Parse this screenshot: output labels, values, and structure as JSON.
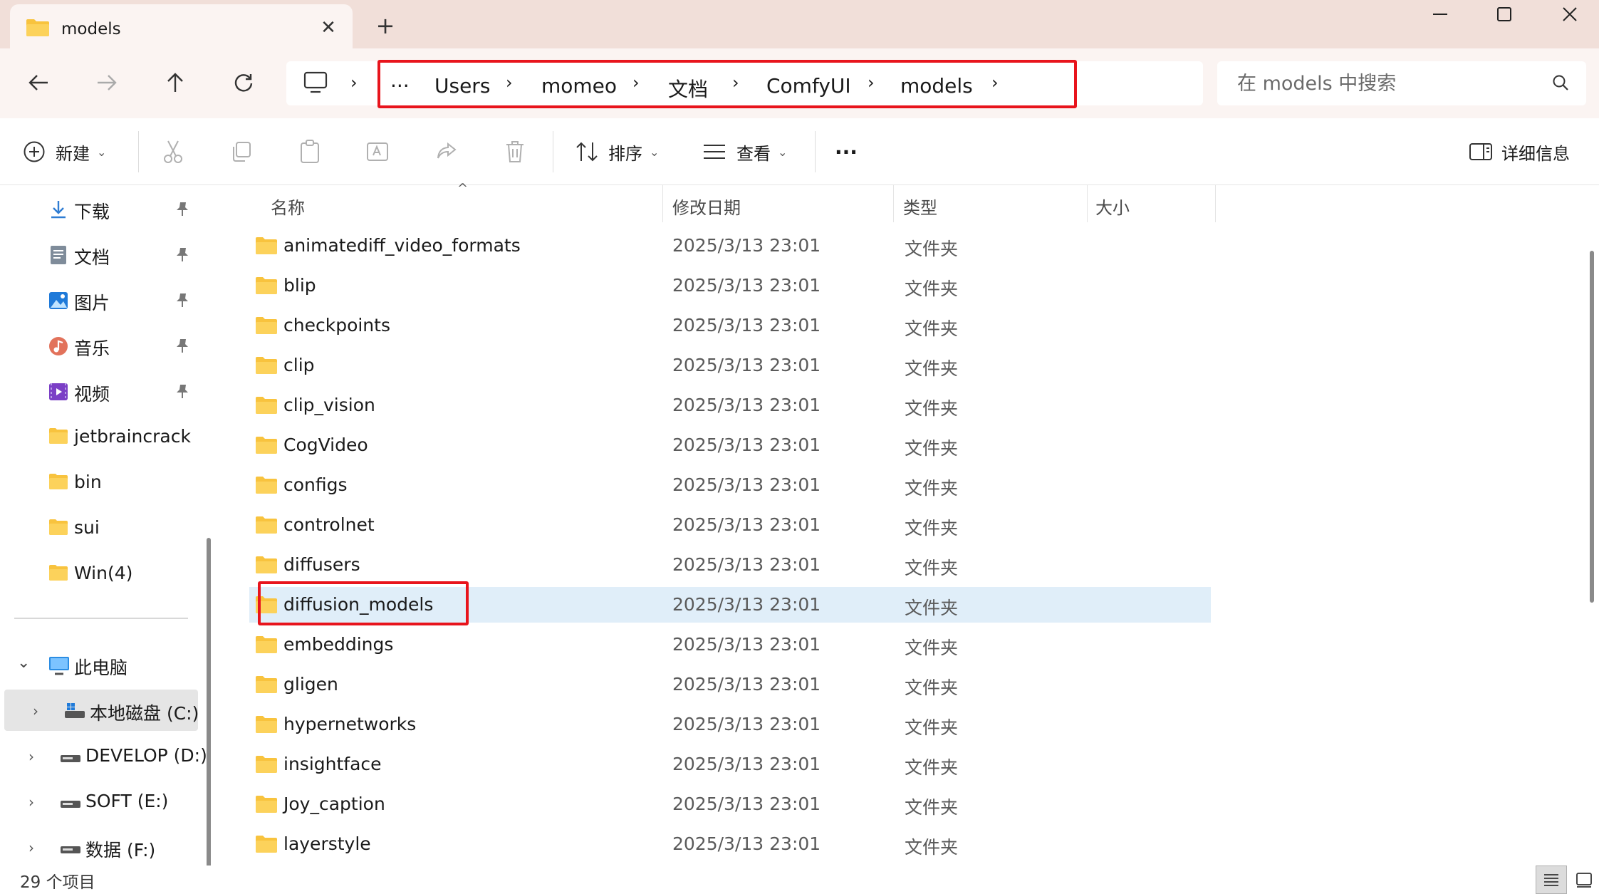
{
  "window": {
    "tab_title": "models",
    "new_tab_label": "+",
    "close_tab_label": "✕"
  },
  "nav": {
    "overflow_label": "···",
    "breadcrumbs": [
      "Users",
      "momeo",
      "文档",
      "ComfyUI",
      "models"
    ],
    "search_placeholder": "在 models 中搜索"
  },
  "toolbar": {
    "new_label": "新建",
    "sort_label": "排序",
    "view_label": "查看",
    "more_label": "···",
    "details_label": "详细信息"
  },
  "sidebar": {
    "quick_access": [
      {
        "label": "下载",
        "icon": "download-icon",
        "pinned": true
      },
      {
        "label": "文档",
        "icon": "document-icon",
        "pinned": true
      },
      {
        "label": "图片",
        "icon": "picture-icon",
        "pinned": true
      },
      {
        "label": "音乐",
        "icon": "music-icon",
        "pinned": true
      },
      {
        "label": "视频",
        "icon": "video-icon",
        "pinned": true
      },
      {
        "label": "jetbraincrack",
        "icon": "folder-icon",
        "pinned": false
      },
      {
        "label": "bin",
        "icon": "folder-icon",
        "pinned": false
      },
      {
        "label": "sui",
        "icon": "folder-icon",
        "pinned": false
      },
      {
        "label": "Win(4)",
        "icon": "folder-icon",
        "pinned": false
      }
    ],
    "this_pc_label": "此电脑",
    "drives": [
      {
        "label": "本地磁盘 (C:)",
        "selected": true
      },
      {
        "label": "DEVELOP (D:)",
        "selected": false
      },
      {
        "label": "SOFT (E:)",
        "selected": false
      },
      {
        "label": "数据 (F:)",
        "selected": false
      }
    ]
  },
  "list": {
    "columns": [
      "名称",
      "修改日期",
      "类型",
      "大小"
    ],
    "rows": [
      {
        "name": "animatediff_video_formats",
        "date": "2025/3/13 23:01",
        "type": "文件夹"
      },
      {
        "name": "blip",
        "date": "2025/3/13 23:01",
        "type": "文件夹"
      },
      {
        "name": "checkpoints",
        "date": "2025/3/13 23:01",
        "type": "文件夹"
      },
      {
        "name": "clip",
        "date": "2025/3/13 23:01",
        "type": "文件夹"
      },
      {
        "name": "clip_vision",
        "date": "2025/3/13 23:01",
        "type": "文件夹"
      },
      {
        "name": "CogVideo",
        "date": "2025/3/13 23:01",
        "type": "文件夹"
      },
      {
        "name": "configs",
        "date": "2025/3/13 23:01",
        "type": "文件夹"
      },
      {
        "name": "controlnet",
        "date": "2025/3/13 23:01",
        "type": "文件夹"
      },
      {
        "name": "diffusers",
        "date": "2025/3/13 23:01",
        "type": "文件夹"
      },
      {
        "name": "diffusion_models",
        "date": "2025/3/13 23:01",
        "type": "文件夹",
        "selected": true
      },
      {
        "name": "embeddings",
        "date": "2025/3/13 23:01",
        "type": "文件夹"
      },
      {
        "name": "gligen",
        "date": "2025/3/13 23:01",
        "type": "文件夹"
      },
      {
        "name": "hypernetworks",
        "date": "2025/3/13 23:01",
        "type": "文件夹"
      },
      {
        "name": "insightface",
        "date": "2025/3/13 23:01",
        "type": "文件夹"
      },
      {
        "name": "Joy_caption",
        "date": "2025/3/13 23:01",
        "type": "文件夹"
      },
      {
        "name": "layerstyle",
        "date": "2025/3/13 23:01",
        "type": "文件夹"
      }
    ]
  },
  "status": {
    "item_count": "29 个项目"
  },
  "colors": {
    "titlebar_bg": "#f1dfd9",
    "navbar_bg": "#fbf4f2",
    "highlight_red": "#e8141c",
    "selected_row": "#e0eef9",
    "folder_yellow": "#f8c33e"
  }
}
